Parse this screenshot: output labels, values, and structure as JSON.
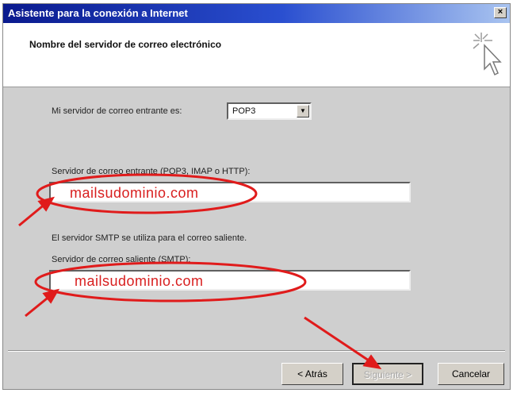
{
  "window": {
    "title": "Asistente para la conexión a Internet",
    "close_glyph": "×"
  },
  "header": {
    "title": "Nombre del servidor de correo electrónico",
    "icon": "cursor-sparkle-icon"
  },
  "incoming_type": {
    "label": "Mi servidor de correo entrante es:",
    "value": "POP3"
  },
  "incoming_server": {
    "label": "Servidor de correo entrante (POP3, IMAP o HTTP):",
    "value": "mailsudominio.com"
  },
  "smtp_note": "El servidor SMTP se utiliza para el correo saliente.",
  "outgoing_server": {
    "label": "Servidor de correo saliente (SMTP):",
    "value": "mailsudominio.com"
  },
  "buttons": {
    "back": "< Atrás",
    "next": "Siguiente >",
    "cancel": "Cancelar"
  },
  "annotation_color": "#e01b1b"
}
